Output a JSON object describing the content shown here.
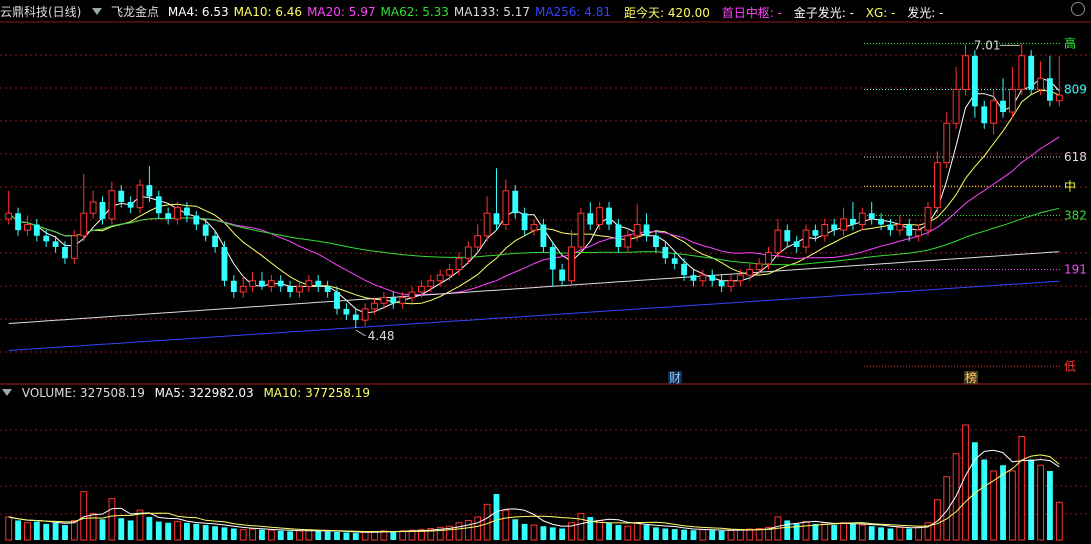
{
  "header": {
    "stock_name": "云鼎科技(日线)",
    "indicator": "飞龙金点",
    "ma_items": [
      {
        "label": "MA4: 6.53",
        "color": "#ffffff"
      },
      {
        "label": "MA10: 6.46",
        "color": "#ffff66"
      },
      {
        "label": "MA20: 5.97",
        "color": "#ff44ff"
      },
      {
        "label": "MA62: 5.33",
        "color": "#33dd33"
      },
      {
        "label": "MA133: 5.17",
        "color": "#dddddd"
      },
      {
        "label": "MA256: 4.81",
        "color": "#3344ff"
      }
    ]
  },
  "right_info": {
    "days": "距今天: 420.00",
    "first_day": "首日中枢: -",
    "gold": "金子发光: -",
    "xg": "XG: -",
    "fg": "发光: -"
  },
  "volume_header": {
    "volume": "VOLUME: 327508.19",
    "ma5": "MA5: 322982.03",
    "ma10": "MA10: 377258.19"
  },
  "price_labels": {
    "high_mark": "7.01",
    "low_mark": "4.48",
    "fib_809": "809",
    "fib_618": "618",
    "fib_mid": "中",
    "fib_382": "382",
    "fib_191": "191",
    "fib_low": "低",
    "fib_high": "高",
    "event_cai": "财",
    "event_bang": "榜"
  },
  "colors": {
    "up": "#ff3333",
    "down": "#33ffff",
    "grid": "#8b1a1a"
  },
  "chart_data": {
    "type": "candlestick",
    "y_price_range": [
      4.0,
      7.2
    ],
    "highest": 7.01,
    "lowest": 4.48,
    "candles": [
      [
        5.45,
        5.5,
        5.7,
        5.4
      ],
      [
        5.5,
        5.35,
        5.55,
        5.3
      ],
      [
        5.35,
        5.4,
        5.48,
        5.3
      ],
      [
        5.4,
        5.3,
        5.45,
        5.25
      ],
      [
        5.3,
        5.25,
        5.35,
        5.2
      ],
      [
        5.25,
        5.2,
        5.3,
        5.15
      ],
      [
        5.2,
        5.1,
        5.25,
        5.05
      ],
      [
        5.1,
        5.3,
        5.35,
        5.05
      ],
      [
        5.3,
        5.5,
        5.85,
        5.25
      ],
      [
        5.5,
        5.6,
        5.7,
        5.45
      ],
      [
        5.6,
        5.45,
        5.65,
        5.4
      ],
      [
        5.45,
        5.7,
        5.78,
        5.4
      ],
      [
        5.7,
        5.6,
        5.75,
        5.55
      ],
      [
        5.6,
        5.55,
        5.65,
        5.5
      ],
      [
        5.55,
        5.75,
        5.8,
        5.5
      ],
      [
        5.75,
        5.65,
        5.92,
        5.6
      ],
      [
        5.65,
        5.5,
        5.7,
        5.45
      ],
      [
        5.5,
        5.45,
        5.55,
        5.4
      ],
      [
        5.45,
        5.55,
        5.6,
        5.4
      ],
      [
        5.55,
        5.48,
        5.6,
        5.42
      ],
      [
        5.48,
        5.4,
        5.52,
        5.35
      ],
      [
        5.4,
        5.3,
        5.45,
        5.25
      ],
      [
        5.3,
        5.2,
        5.35,
        5.15
      ],
      [
        5.2,
        4.9,
        5.25,
        4.85
      ],
      [
        4.9,
        4.8,
        4.95,
        4.75
      ],
      [
        4.8,
        4.85,
        4.95,
        4.75
      ],
      [
        4.85,
        4.9,
        4.98,
        4.8
      ],
      [
        4.9,
        4.85,
        4.98,
        4.82
      ],
      [
        4.85,
        4.9,
        4.95,
        4.8
      ],
      [
        4.9,
        4.85,
        4.95,
        4.8
      ],
      [
        4.85,
        4.8,
        4.9,
        4.75
      ],
      [
        4.8,
        4.85,
        4.9,
        4.75
      ],
      [
        4.85,
        4.9,
        4.95,
        4.8
      ],
      [
        4.9,
        4.85,
        4.95,
        4.8
      ],
      [
        4.85,
        4.8,
        4.9,
        4.75
      ],
      [
        4.8,
        4.65,
        4.85,
        4.6
      ],
      [
        4.65,
        4.6,
        4.7,
        4.55
      ],
      [
        4.6,
        4.55,
        4.65,
        4.48
      ],
      [
        4.55,
        4.65,
        4.7,
        4.5
      ],
      [
        4.65,
        4.7,
        4.75,
        4.6
      ],
      [
        4.7,
        4.75,
        4.8,
        4.65
      ],
      [
        4.75,
        4.7,
        4.8,
        4.65
      ],
      [
        4.7,
        4.75,
        4.8,
        4.65
      ],
      [
        4.75,
        4.8,
        4.85,
        4.7
      ],
      [
        4.8,
        4.85,
        4.9,
        4.75
      ],
      [
        4.85,
        4.9,
        4.95,
        4.8
      ],
      [
        4.9,
        4.95,
        5.0,
        4.85
      ],
      [
        4.95,
        5.0,
        5.05,
        4.9
      ],
      [
        5.0,
        5.1,
        5.15,
        4.95
      ],
      [
        5.1,
        5.2,
        5.25,
        5.05
      ],
      [
        5.2,
        5.3,
        5.4,
        5.15
      ],
      [
        5.3,
        5.5,
        5.65,
        5.25
      ],
      [
        5.5,
        5.4,
        5.9,
        5.35
      ],
      [
        5.4,
        5.7,
        5.8,
        5.35
      ],
      [
        5.7,
        5.5,
        5.75,
        5.45
      ],
      [
        5.5,
        5.35,
        5.55,
        5.3
      ],
      [
        5.35,
        5.4,
        5.45,
        5.3
      ],
      [
        5.4,
        5.2,
        5.45,
        5.15
      ],
      [
        5.2,
        5.0,
        5.25,
        4.85
      ],
      [
        5.0,
        4.9,
        5.05,
        4.85
      ],
      [
        4.9,
        5.2,
        5.35,
        4.85
      ],
      [
        5.2,
        5.5,
        5.55,
        5.15
      ],
      [
        5.5,
        5.4,
        5.6,
        5.35
      ],
      [
        5.4,
        5.55,
        5.6,
        5.35
      ],
      [
        5.55,
        5.4,
        5.6,
        5.35
      ],
      [
        5.4,
        5.2,
        5.45,
        5.15
      ],
      [
        5.2,
        5.3,
        5.35,
        5.15
      ],
      [
        5.3,
        5.4,
        5.58,
        5.25
      ],
      [
        5.4,
        5.3,
        5.5,
        5.25
      ],
      [
        5.3,
        5.2,
        5.35,
        5.15
      ],
      [
        5.2,
        5.1,
        5.25,
        5.05
      ],
      [
        5.1,
        5.05,
        5.15,
        5.0
      ],
      [
        5.05,
        4.95,
        5.1,
        4.9
      ],
      [
        4.95,
        4.9,
        5.0,
        4.85
      ],
      [
        4.9,
        4.95,
        5.0,
        4.85
      ],
      [
        4.95,
        4.9,
        5.0,
        4.85
      ],
      [
        4.9,
        4.85,
        4.95,
        4.8
      ],
      [
        4.85,
        4.9,
        4.95,
        4.8
      ],
      [
        4.9,
        4.95,
        5.0,
        4.85
      ],
      [
        4.95,
        5.0,
        5.05,
        4.9
      ],
      [
        5.0,
        5.05,
        5.1,
        4.95
      ],
      [
        5.05,
        5.15,
        5.2,
        5.0
      ],
      [
        5.15,
        5.35,
        5.45,
        5.1
      ],
      [
        5.35,
        5.25,
        5.4,
        5.2
      ],
      [
        5.25,
        5.2,
        5.3,
        5.15
      ],
      [
        5.2,
        5.35,
        5.4,
        5.15
      ],
      [
        5.35,
        5.3,
        5.4,
        5.25
      ],
      [
        5.3,
        5.4,
        5.45,
        5.25
      ],
      [
        5.4,
        5.35,
        5.45,
        5.3
      ],
      [
        5.35,
        5.45,
        5.55,
        5.3
      ],
      [
        5.45,
        5.4,
        5.6,
        5.35
      ],
      [
        5.4,
        5.5,
        5.55,
        5.35
      ],
      [
        5.5,
        5.45,
        5.6,
        5.4
      ],
      [
        5.45,
        5.4,
        5.5,
        5.35
      ],
      [
        5.4,
        5.35,
        5.45,
        5.3
      ],
      [
        5.35,
        5.4,
        5.48,
        5.3
      ],
      [
        5.4,
        5.3,
        5.45,
        5.25
      ],
      [
        5.3,
        5.35,
        5.4,
        5.25
      ],
      [
        5.35,
        5.55,
        5.6,
        5.3
      ],
      [
        5.55,
        5.95,
        6.05,
        5.5
      ],
      [
        5.95,
        6.3,
        6.4,
        5.9
      ],
      [
        6.3,
        6.6,
        6.8,
        6.25
      ],
      [
        6.6,
        6.9,
        7.0,
        6.55
      ],
      [
        6.9,
        6.45,
        6.95,
        6.35
      ],
      [
        6.45,
        6.3,
        6.5,
        6.25
      ],
      [
        6.3,
        6.5,
        6.6,
        6.2
      ],
      [
        6.5,
        6.4,
        6.7,
        6.35
      ],
      [
        6.4,
        6.6,
        6.8,
        6.35
      ],
      [
        6.6,
        6.9,
        7.01,
        6.55
      ],
      [
        6.9,
        6.6,
        6.95,
        6.55
      ],
      [
        6.6,
        6.7,
        6.85,
        6.55
      ],
      [
        6.7,
        6.5,
        6.9,
        6.45
      ],
      [
        6.5,
        6.55,
        6.9,
        6.45
      ]
    ],
    "volume_range": [
      0,
      1200000
    ],
    "volumes": [
      200000,
      170000,
      150000,
      160000,
      140000,
      150000,
      130000,
      170000,
      420000,
      230000,
      180000,
      360000,
      190000,
      170000,
      260000,
      200000,
      160000,
      150000,
      160000,
      150000,
      140000,
      130000,
      120000,
      110000,
      100000,
      90000,
      95000,
      90000,
      85000,
      80000,
      75000,
      80000,
      85000,
      80000,
      75000,
      70000,
      65000,
      60000,
      70000,
      75000,
      80000,
      75000,
      80000,
      85000,
      90000,
      100000,
      110000,
      120000,
      150000,
      170000,
      200000,
      310000,
      400000,
      260000,
      180000,
      140000,
      130000,
      120000,
      110000,
      100000,
      150000,
      230000,
      200000,
      170000,
      150000,
      130000,
      120000,
      150000,
      130000,
      110000,
      100000,
      95000,
      90000,
      85000,
      90000,
      85000,
      80000,
      85000,
      90000,
      95000,
      100000,
      110000,
      200000,
      170000,
      140000,
      160000,
      140000,
      150000,
      130000,
      150000,
      140000,
      130000,
      120000,
      110000,
      100000,
      110000,
      100000,
      110000,
      150000,
      350000,
      550000,
      750000,
      1000000,
      850000,
      700000,
      600000,
      650000,
      600000,
      900000,
      700000,
      650000,
      600000,
      327508
    ]
  }
}
